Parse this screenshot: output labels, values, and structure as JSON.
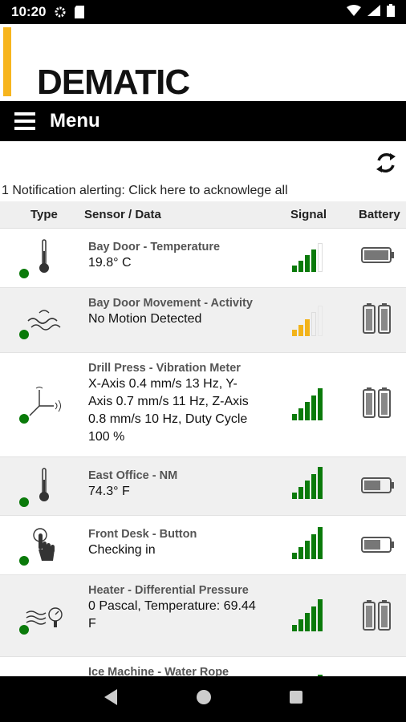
{
  "status": {
    "time": "10:20"
  },
  "brand": {
    "logo": "DEMATIC"
  },
  "menu": {
    "title": "Menu"
  },
  "notification": {
    "text": "1 Notification alerting: Click here to acknowlege all"
  },
  "table": {
    "headers": {
      "type": "Type",
      "sensor": "Sensor / Data",
      "signal": "Signal",
      "battery": "Battery"
    },
    "rows": [
      {
        "name": "Bay Door - Temperature",
        "data": "19.8° C",
        "icon": "thermometer-icon",
        "signal_level": 4,
        "signal_color": "#0a7a0a",
        "battery": "horizontal-full"
      },
      {
        "name": "Bay Door Movement - Activity",
        "data": "No Motion Detected",
        "icon": "activity-wave-icon",
        "signal_level": 3,
        "signal_color": "#f2b31a",
        "battery": "double-cell"
      },
      {
        "name": "Drill Press - Vibration Meter",
        "data": "X-Axis 0.4 mm/s 13 Hz, Y-Axis 0.7 mm/s 11 Hz, Z-Axis 0.8 mm/s 10 Hz, Duty Cycle 100 %",
        "icon": "vibration-axis-icon",
        "signal_level": 5,
        "signal_color": "#0a7a0a",
        "battery": "double-cell"
      },
      {
        "name": "East Office - NM",
        "data": "74.3° F",
        "icon": "thermometer-icon",
        "signal_level": 5,
        "signal_color": "#0a7a0a",
        "battery": "horizontal-partial"
      },
      {
        "name": "Front Desk - Button",
        "data": "Checking in",
        "icon": "hand-press-icon",
        "signal_level": 5,
        "signal_color": "#0a7a0a",
        "battery": "horizontal-partial"
      },
      {
        "name": "Heater - Differential Pressure",
        "data": "0 Pascal, Temperature: 69.44 F",
        "icon": "pressure-gauge-icon",
        "signal_level": 5,
        "signal_color": "#0a7a0a",
        "battery": "double-cell"
      },
      {
        "name": "Ice Machine - Water Rope",
        "data": "",
        "icon": "water-rope-icon",
        "signal_level": 5,
        "signal_color": "#0a7a0a",
        "battery": "double-cell"
      }
    ]
  }
}
